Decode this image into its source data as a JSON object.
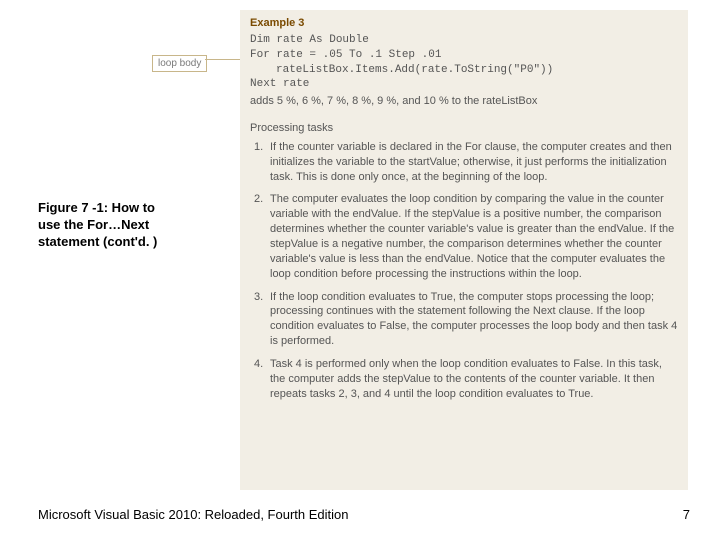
{
  "loop_label": "loop body",
  "example": {
    "title": "Example 3",
    "line1": "Dim rate As Double",
    "line2": "For rate = .05 To .1 Step .01",
    "line3": "rateListBox.Items.Add(rate.ToString(\"P0\"))",
    "line4": "Next rate",
    "after": "adds 5 %, 6 %, 7 %, 8 %, 9 %, and 10 % to the rateListBox"
  },
  "proc_title": "Processing tasks",
  "tasks": [
    {
      "n": "1.",
      "t": "If the counter variable is declared in the For clause, the computer creates and then initializes the variable to the startValue; otherwise, it just performs the initialization task. This is done only once, at the beginning of the loop."
    },
    {
      "n": "2.",
      "t": "The computer evaluates the loop condition by comparing the value in the counter variable with the endValue. If the stepValue is a positive number, the comparison determines whether the counter variable's value is greater than the endValue. If the stepValue is a negative number, the comparison determines whether the counter variable's value is less than the endValue. Notice that the computer evaluates the loop condition before processing the instructions within the loop."
    },
    {
      "n": "3.",
      "t": "If the loop condition evaluates to True, the computer stops processing the loop; processing continues with the statement following the Next clause. If the loop condition evaluates to False, the computer processes the loop body and then task 4 is performed."
    },
    {
      "n": "4.",
      "t": "Task 4 is performed only when the loop condition evaluates to False. In this task, the computer adds the stepValue to the contents of the counter variable. It then repeats tasks 2, 3, and 4 until the loop condition evaluates to True."
    }
  ],
  "caption": "Figure 7 -1: How to use the For…Next statement (cont'd. )",
  "footer_left": "Microsoft Visual Basic 2010: Reloaded, Fourth Edition",
  "page_num": "7"
}
